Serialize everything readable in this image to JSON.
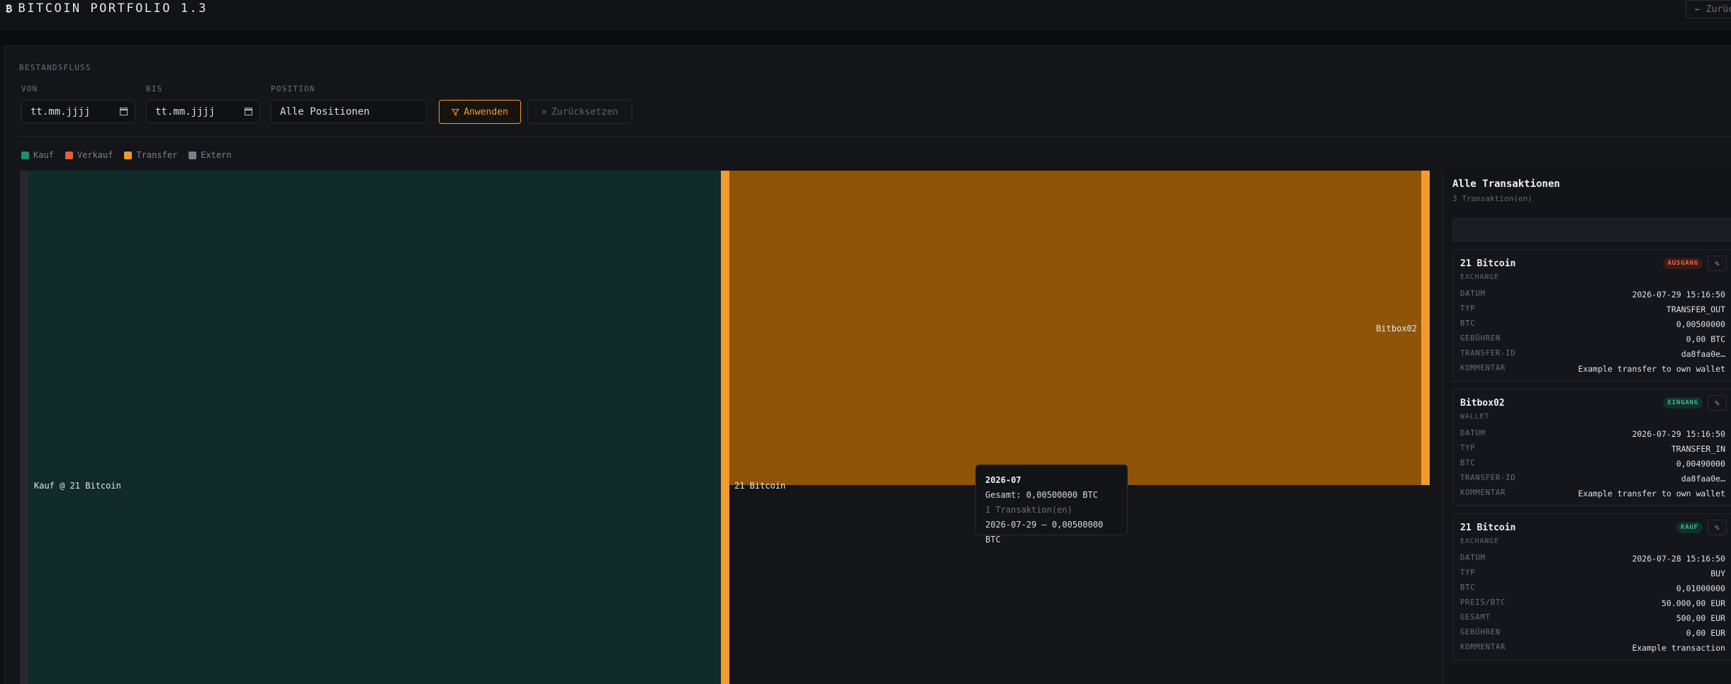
{
  "app": {
    "title": "BITCOIN PORTFOLIO 1.3",
    "back_label": "← Zurück"
  },
  "section": {
    "title": "BESTANDSFLUSS"
  },
  "filters": {
    "from_label": "VON",
    "from_value": "tt.mm.jjjj",
    "to_label": "BIS",
    "to_value": "tt.mm.jjjj",
    "position_label": "POSITION",
    "position_value": "Alle Positionen",
    "apply_label": "Anwenden",
    "reset_label": "Zurücksetzen"
  },
  "legend": [
    {
      "label": "Kauf",
      "color": "#1f8f6a"
    },
    {
      "label": "Verkauf",
      "color": "#e0613a"
    },
    {
      "label": "Transfer",
      "color": "#f29a2e"
    },
    {
      "label": "Extern",
      "color": "#7a7e86"
    }
  ],
  "flow": {
    "colors": {
      "kauf": "#112a2a",
      "transfer_node": "#f29a2e",
      "transfer_band": "#8f5408",
      "extern": "#26292f"
    },
    "nodes": [
      {
        "label": "Kauf @ 21 Bitcoin",
        "btc": 0.01,
        "type": "extern"
      },
      {
        "label": "21 Bitcoin",
        "btc": 0.01,
        "type": "transfer"
      },
      {
        "label": "Bitbox02",
        "btc": 0.0049,
        "type": "transfer"
      }
    ],
    "links": [
      {
        "from": "Kauf @ 21 Bitcoin",
        "to": "21 Bitcoin",
        "btc": 0.01,
        "type": "kauf"
      },
      {
        "from": "21 Bitcoin",
        "to": "Bitbox02",
        "btc": 0.005,
        "type": "transfer"
      }
    ]
  },
  "tooltip": {
    "title": "2026-07",
    "total": "Gesamt: 0,00500000 BTC",
    "count": "1 Transaktion(en)",
    "entry": "2026-07-29 — 0,00500000 BTC"
  },
  "panel": {
    "title": "Alle Transaktionen",
    "subtitle": "3 Transaktion(en)",
    "transactions": [
      {
        "name": "21 Bitcoin",
        "kind": "EXCHANGE",
        "badge": "AUSGANG",
        "rows": [
          {
            "k": "DATUM",
            "v": "2026-07-29 15:16:50"
          },
          {
            "k": "TYP",
            "v": "TRANSFER_OUT"
          },
          {
            "k": "BTC",
            "v": "0,00500000"
          },
          {
            "k": "GEBÜHREN",
            "v": "0,00 BTC"
          },
          {
            "k": "TRANSFER-ID",
            "v": "da8faa0e…"
          },
          {
            "k": "KOMMENTAR",
            "v": "Example transfer to own wallet"
          }
        ]
      },
      {
        "name": "Bitbox02",
        "kind": "WALLET",
        "badge": "EINGANG",
        "rows": [
          {
            "k": "DATUM",
            "v": "2026-07-29 15:16:50"
          },
          {
            "k": "TYP",
            "v": "TRANSFER_IN"
          },
          {
            "k": "BTC",
            "v": "0,00490000"
          },
          {
            "k": "TRANSFER-ID",
            "v": "da8faa0e…"
          },
          {
            "k": "KOMMENTAR",
            "v": "Example transfer to own wallet"
          }
        ]
      },
      {
        "name": "21 Bitcoin",
        "kind": "EXCHANGE",
        "badge": "KAUF",
        "rows": [
          {
            "k": "DATUM",
            "v": "2026-07-28 15:16:50"
          },
          {
            "k": "TYP",
            "v": "BUY"
          },
          {
            "k": "BTC",
            "v": "0,01000000"
          },
          {
            "k": "PREIS/BTC",
            "v": "50.000,00 EUR"
          },
          {
            "k": "GESAMT",
            "v": "500,00 EUR"
          },
          {
            "k": "GEBÜHREN",
            "v": "0,00 EUR"
          },
          {
            "k": "KOMMENTAR",
            "v": "Example transaction"
          }
        ]
      }
    ]
  }
}
